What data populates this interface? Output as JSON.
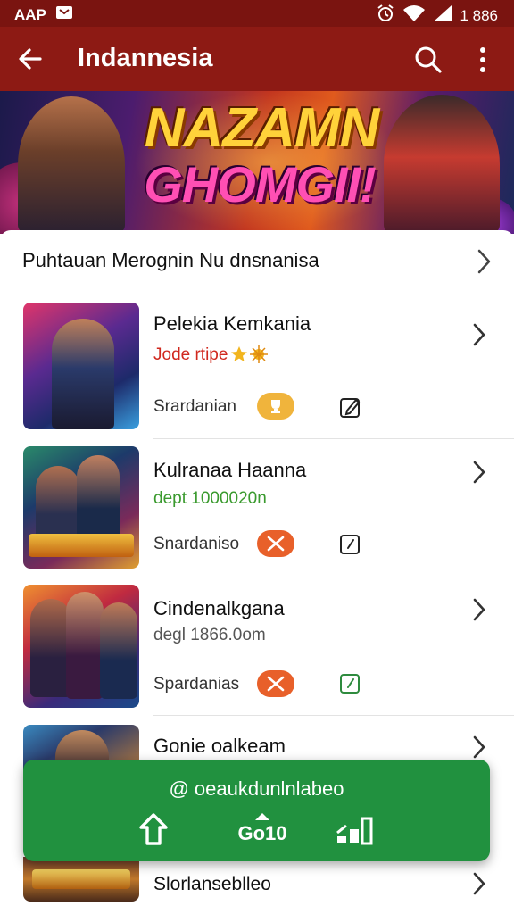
{
  "status_bar": {
    "carrier": "AAP",
    "time": "1 886"
  },
  "app_bar": {
    "title": "Indannesia"
  },
  "banner": {
    "line1": "NAZAMN",
    "line2": "GHOMGII!"
  },
  "section": {
    "header": "Puhtauan Merognin Nu dnsnanisa"
  },
  "items": [
    {
      "title": "Pelekia Kemkania",
      "subtitle": "Jode rtipe",
      "subtitle_color": "#d0281e",
      "meta": "Srardanian",
      "badge_color": "#f0b43c",
      "edit_color": "#222222"
    },
    {
      "title": "Kulranaa Haanna",
      "subtitle": "dept 1000020n",
      "subtitle_color": "#3a9a2e",
      "meta": "Snardaniso",
      "badge_color": "#e8602a",
      "edit_color": "#222222"
    },
    {
      "title": "Cindenalkgana",
      "subtitle": "degl 1866.0om",
      "subtitle_color": "#555555",
      "meta": "Spardanias",
      "badge_color": "#e8602a",
      "edit_color": "#2e8b3e"
    },
    {
      "title": "Gonie oalkeam",
      "subtitle": "",
      "subtitle_color": "#555555",
      "meta": "",
      "badge_color": "#e8602a",
      "edit_color": "#222222"
    }
  ],
  "toast": {
    "message": "@ oeaukdunlnlabeo",
    "action_label": "Go10"
  },
  "footer": {
    "label": "Slorlanseblleo"
  },
  "colors": {
    "app_bar": "#8d1a14",
    "status_bar": "#7a1410",
    "toast": "#21913f"
  }
}
